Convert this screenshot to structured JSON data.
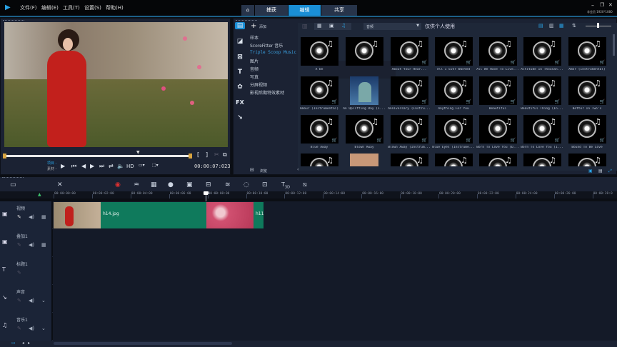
{
  "app": {
    "menus": [
      "文件(F)",
      "编辑(E)",
      "工具(T)",
      "设置(S)",
      "帮助(H)"
    ],
    "tabs": [
      {
        "label": "捕获"
      },
      {
        "label": "编辑",
        "active": true
      },
      {
        "label": "共享"
      }
    ],
    "status": "非会员 1920*1080",
    "accent": "#1a8fd6"
  },
  "preview": {
    "mode_project": "项目 -",
    "mode_clip": "素材 -",
    "hd": "HD",
    "timecode": "00:00:07:023"
  },
  "library": {
    "add_label": "添加",
    "dropdown": "音频",
    "filter_label": "仅供个人使用",
    "browse_label": "浏览",
    "categories": [
      {
        "label": "样本"
      },
      {
        "label": "ScoreFitter 音乐"
      },
      {
        "label": "Triple Scoop Music",
        "selected": true
      },
      {
        "label": "图片"
      },
      {
        "label": "音频"
      },
      {
        "label": "写真"
      },
      {
        "label": "分屏视频"
      },
      {
        "label": "影视后期特效素材"
      }
    ],
    "items": [
      {
        "label": "A Be",
        "icon": "audio"
      },
      {
        "label": "",
        "icon": "audio"
      },
      {
        "label": "About Your Hear...",
        "icon": "audio"
      },
      {
        "label": "All I Ever Wanted",
        "icon": "audio"
      },
      {
        "label": "All We Have To Live...",
        "icon": "audio"
      },
      {
        "label": "Altitude In Thousan...",
        "icon": "audio"
      },
      {
        "label": "Amor (Instrumental)",
        "icon": "audio"
      },
      {
        "label": "Amour (Instrumental)",
        "icon": "audio"
      },
      {
        "label": "An Uplifting Day (I...",
        "icon": "photo"
      },
      {
        "label": "Anniversary (Instru...",
        "icon": "audio"
      },
      {
        "label": "Anything For You",
        "icon": "audio"
      },
      {
        "label": "Beautiful",
        "icon": "audio"
      },
      {
        "label": "Beautiful Thing (In...",
        "icon": "audio"
      },
      {
        "label": "Better In Two's",
        "icon": "audio"
      },
      {
        "label": "Blue Away",
        "icon": "audio"
      },
      {
        "label": "Blown Away",
        "icon": "audio"
      },
      {
        "label": "Blown Away (Instrum...",
        "icon": "audio"
      },
      {
        "label": "Blue Eyes (Instrume...",
        "icon": "audio"
      },
      {
        "label": "Born To Love You (D...",
        "icon": "audio"
      },
      {
        "label": "Born To Love You (I...",
        "icon": "audio"
      },
      {
        "label": "Bound To Be Love",
        "icon": "audio"
      },
      {
        "label": "",
        "icon": "audio"
      },
      {
        "label": "",
        "icon": "photo2"
      },
      {
        "label": "",
        "icon": "audio"
      },
      {
        "label": "",
        "icon": "audio"
      },
      {
        "label": "",
        "icon": "audio"
      },
      {
        "label": "",
        "icon": "audio"
      },
      {
        "label": "",
        "icon": "audio"
      }
    ]
  },
  "timeline": {
    "ruler": [
      "00:00:00:00",
      "00:00:02:00",
      "00:00:04:00",
      "00:00:06:00",
      "00:00:08:00",
      "00:00:10:00",
      "00:00:12:00",
      "00:00:14:00",
      "00:00:16:00",
      "00:00:18:00",
      "00:00:20:00",
      "00:00:22:00",
      "00:00:24:00",
      "00:00:26:00",
      "00:00:28:0"
    ],
    "tracks": [
      {
        "name": "视频",
        "icon": "video-track-icon"
      },
      {
        "name": "叠加1",
        "icon": "overlay-track-icon"
      },
      {
        "name": "标题1",
        "icon": "title-track-icon"
      },
      {
        "name": "声音",
        "icon": "voice-track-icon"
      },
      {
        "name": "音乐1",
        "icon": "music-track-icon"
      }
    ],
    "clips": [
      {
        "label": "h14.jpg",
        "color": "#0f7a5c"
      },
      {
        "label": "h11",
        "color": "#0f7a5c"
      }
    ]
  }
}
